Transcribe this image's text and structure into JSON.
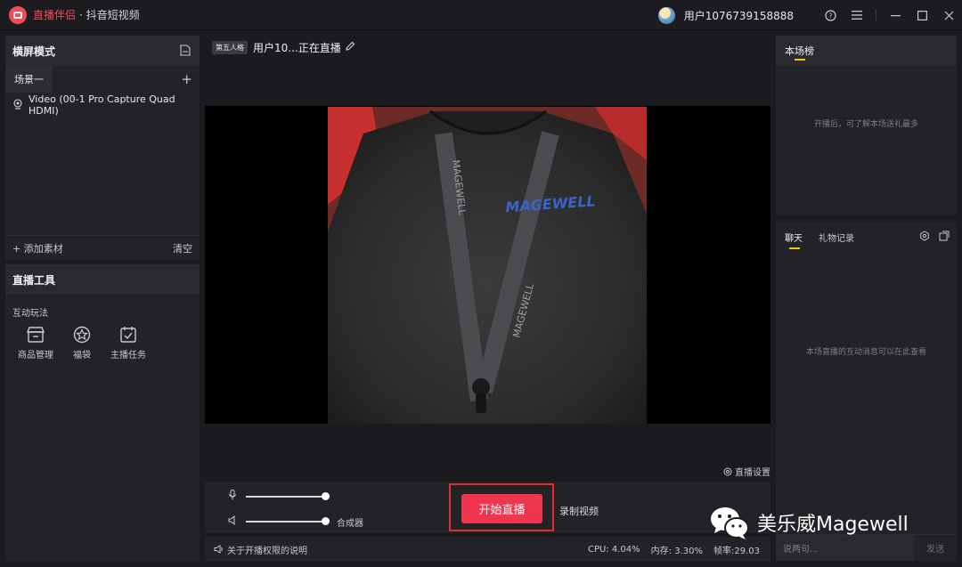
{
  "titlebar": {
    "app_name": "直播伴侣",
    "app_sub": "· 抖音短视频",
    "username": "用户1076739158888",
    "icons": [
      "help-icon",
      "menu-icon",
      "minimize-icon",
      "maximize-icon",
      "close-icon"
    ]
  },
  "scenes": {
    "mode_title": "横屏模式",
    "active_scene": "场景一",
    "sources": [
      "Video (00-1 Pro Capture Quad HDMI)"
    ],
    "add_source": "添加素材",
    "clear": "清空"
  },
  "tools": {
    "title": "直播工具",
    "section": "互动玩法",
    "items": [
      {
        "label": "商品管理",
        "icon": "store-icon"
      },
      {
        "label": "福袋",
        "icon": "lucky-bag-icon"
      },
      {
        "label": "主播任务",
        "icon": "task-icon"
      }
    ]
  },
  "stream": {
    "badge": "第五人格",
    "title": "用户10...正在直播",
    "live_settings": "直播设置"
  },
  "camera": {
    "shirt_logo": "MAGEWELL",
    "lanyard_text": "MAGEWELL"
  },
  "controls": {
    "mic_level": 1.0,
    "speaker_level": 1.0,
    "mixer_label": "合成器",
    "start_button": "开始直播",
    "record_link": "录制视频"
  },
  "status": {
    "note": "关于开播权限的说明",
    "cpu": "CPU: 4.04%",
    "memory": "内存: 3.30%",
    "fps": "帧率:29.03"
  },
  "rank": {
    "title": "本场榜",
    "empty_hint": "开播后，可了解本场送礼最多"
  },
  "chat": {
    "tab_chat": "聊天",
    "tab_gifts": "礼物记录",
    "empty_hint": "本场直播的互动消息可以在此查看",
    "input_placeholder": "说两句...",
    "send": "发送"
  },
  "watermark": {
    "text": "美乐威Magewell"
  },
  "colors": {
    "accent_red": "#f0354f",
    "highlight_frame": "#e0302e",
    "tab_underline": "#f5c518",
    "brand_logo": "#f24b55"
  }
}
